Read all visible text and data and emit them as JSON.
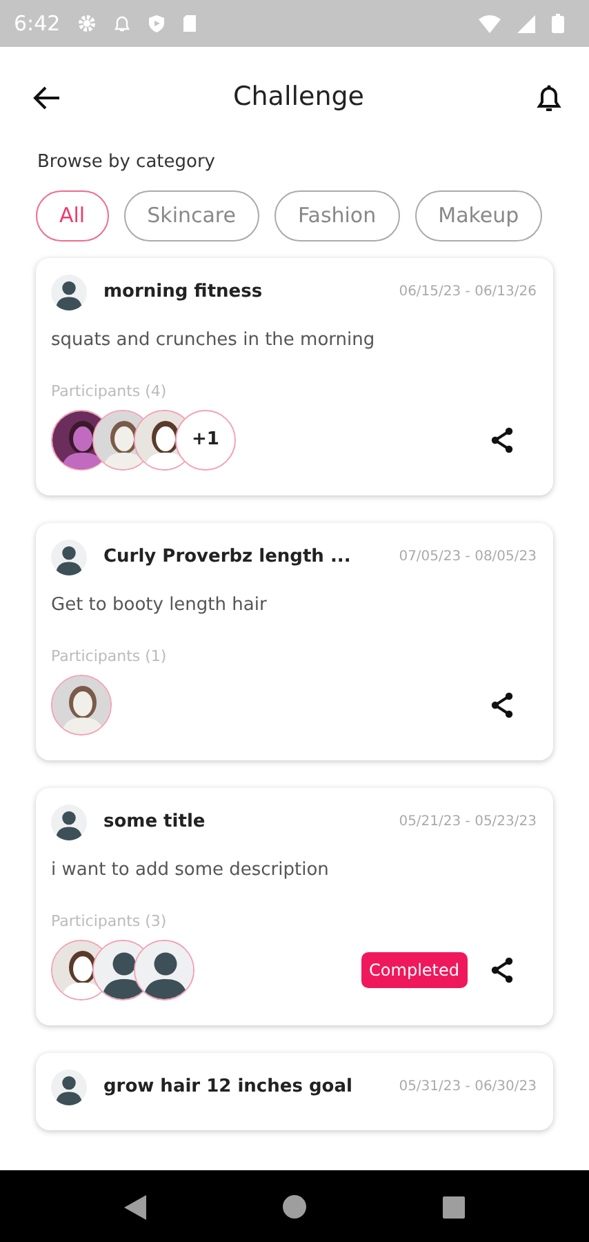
{
  "status_bar": {
    "time": "6:42"
  },
  "header": {
    "title": "Challenge"
  },
  "browse": {
    "label": "Browse by category",
    "categories": [
      {
        "label": "All",
        "selected": true
      },
      {
        "label": "Skincare",
        "selected": false
      },
      {
        "label": "Fashion",
        "selected": false
      },
      {
        "label": "Makeup",
        "selected": false
      }
    ]
  },
  "challenges": [
    {
      "title": "morning fitness",
      "dates": "06/15/23 - 06/13/26",
      "description": "squats and crunches in the morning",
      "participants_label": "Participants (4)",
      "participants": [
        {
          "kind": "picture"
        },
        {
          "kind": "picture"
        },
        {
          "kind": "picture"
        }
      ],
      "more": "+1",
      "completed": false
    },
    {
      "title": "Curly Proverbz length ...",
      "dates": "07/05/23 - 08/05/23",
      "description": "Get to booty length hair",
      "participants_label": "Participants (1)",
      "participants": [
        {
          "kind": "picture"
        }
      ],
      "completed": false
    },
    {
      "title": "some title",
      "dates": "05/21/23 - 05/23/23",
      "description": "i want to add some description",
      "participants_label": "Participants (3)",
      "participants": [
        {
          "kind": "picture"
        },
        {
          "kind": "default"
        },
        {
          "kind": "default"
        }
      ],
      "completed": true,
      "completed_label": "Completed"
    },
    {
      "title": "grow hair 12 inches goal",
      "dates": "05/31/23 - 06/30/23"
    }
  ]
}
